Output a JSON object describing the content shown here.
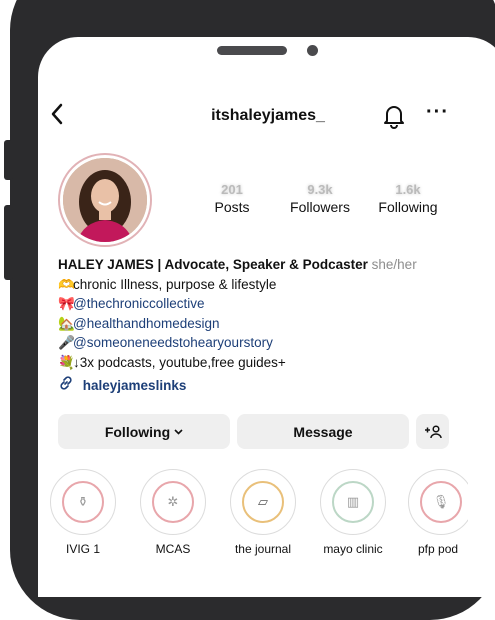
{
  "header": {
    "username": "itshaleyjames_",
    "back_glyph": "<",
    "more_glyph": "···"
  },
  "stats": [
    {
      "value": "201",
      "label": "Posts"
    },
    {
      "value": "9.3k",
      "label": "Followers"
    },
    {
      "value": "1.6k",
      "label": "Following"
    }
  ],
  "bio": {
    "name": "HALEY JAMES | Advocate, Speaker & Podcaster",
    "pronouns": "she/her",
    "line1": "chronic Illness, purpose & lifestyle",
    "line2": "@thechroniccollective",
    "line3": "@healthandhomedesign",
    "line4": "@someoneneedstohearyourstory",
    "line5": "↓3x podcasts, youtube,free guides+",
    "link": "haleyjameslinks"
  },
  "actions": {
    "following": "Following",
    "message": "Message"
  },
  "highlights": [
    {
      "label": "IVIG 1",
      "color": "#e8a6ab"
    },
    {
      "label": "MCAS",
      "color": "#e8a6ab"
    },
    {
      "label": "the journal",
      "color": "#e9c07a"
    },
    {
      "label": "mayo clinic",
      "color": "#bcd7c6"
    },
    {
      "label": "pfp pod",
      "color": "#e8a6ab"
    }
  ]
}
